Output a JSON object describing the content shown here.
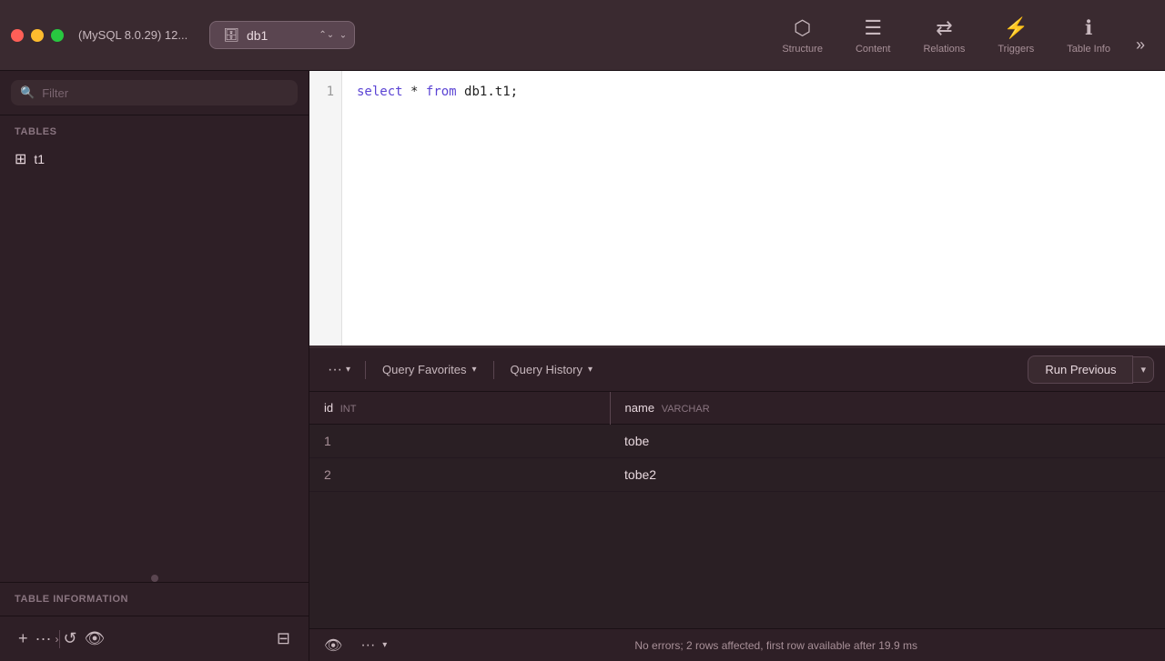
{
  "titlebar": {
    "window_title": "(MySQL 8.0.29) 12...",
    "db_selector": "db1",
    "toolbar": {
      "structure_label": "Structure",
      "content_label": "Content",
      "relations_label": "Relations",
      "triggers_label": "Triggers",
      "table_info_label": "Table Info",
      "more_label": "»"
    }
  },
  "sidebar": {
    "filter_placeholder": "Filter",
    "tables_section_label": "TABLES",
    "tables": [
      {
        "name": "t1",
        "icon": "⊞"
      }
    ],
    "table_info_section_label": "TABLE INFORMATION",
    "footer": {
      "add_label": "+",
      "more_label": "···",
      "refresh_label": "↺",
      "eye_label": "👁"
    }
  },
  "query_editor": {
    "line_number": "1",
    "code": "select * from db1.t1;"
  },
  "query_toolbar": {
    "more_btn_label": "···",
    "query_favorites_label": "Query Favorites",
    "query_history_label": "Query History",
    "run_previous_label": "Run Previous"
  },
  "results": {
    "columns": [
      {
        "name": "id",
        "type": "INT"
      },
      {
        "name": "name",
        "type": "VARCHAR"
      }
    ],
    "rows": [
      {
        "id": "1",
        "name": "tobe"
      },
      {
        "id": "2",
        "name": "tobe2"
      }
    ]
  },
  "status_bar": {
    "message": "No errors; 2 rows affected, first row available after 19.9 ms"
  }
}
